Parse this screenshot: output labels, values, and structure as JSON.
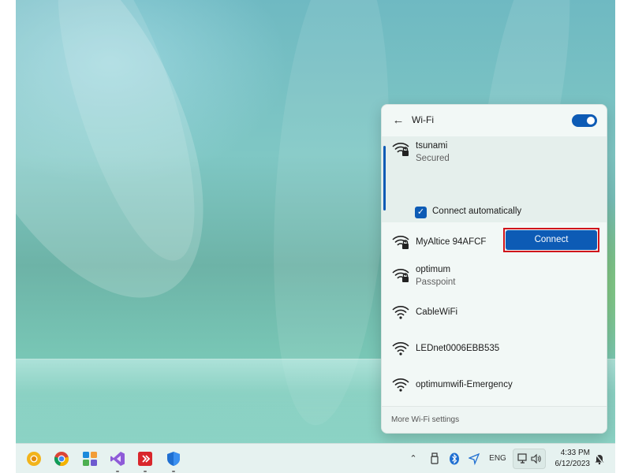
{
  "flyout": {
    "title": "Wi-Fi",
    "wifi_enabled": true,
    "back_icon": "arrow-left-icon",
    "networks": [
      {
        "name": "tsunami",
        "status": "Secured",
        "secured": true,
        "selected": true
      },
      {
        "name": "MyAltice 94AFCF",
        "status": "",
        "secured": true,
        "selected": false
      },
      {
        "name": "optimum",
        "status": "Passpoint",
        "secured": true,
        "selected": false
      },
      {
        "name": "CableWiFi",
        "status": "",
        "secured": false,
        "selected": false
      },
      {
        "name": "LEDnet0006EBB535",
        "status": "",
        "secured": false,
        "selected": false
      },
      {
        "name": "optimumwifi-Emergency",
        "status": "",
        "secured": false,
        "selected": false
      }
    ],
    "connect_automatically_label": "Connect automatically",
    "connect_automatically_checked": true,
    "connect_button_label": "Connect",
    "more_settings_label": "More Wi-Fi settings"
  },
  "taskbar": {
    "apps": [
      {
        "name": "Chrome Canary",
        "icon": "chrome-canary-icon"
      },
      {
        "name": "Chrome",
        "icon": "chrome-icon"
      },
      {
        "name": "Widgets",
        "icon": "widgets-icon"
      },
      {
        "name": "Visual Studio",
        "icon": "visual-studio-icon"
      },
      {
        "name": "Remote app",
        "icon": "remote-app-icon"
      },
      {
        "name": "Windows Security",
        "icon": "shield-icon"
      }
    ],
    "tray": {
      "language": "ENG",
      "time": "4:33 PM",
      "date": "6/12/2023"
    }
  },
  "colors": {
    "accent": "#0d5bb5",
    "highlight_border": "#d0131b"
  }
}
